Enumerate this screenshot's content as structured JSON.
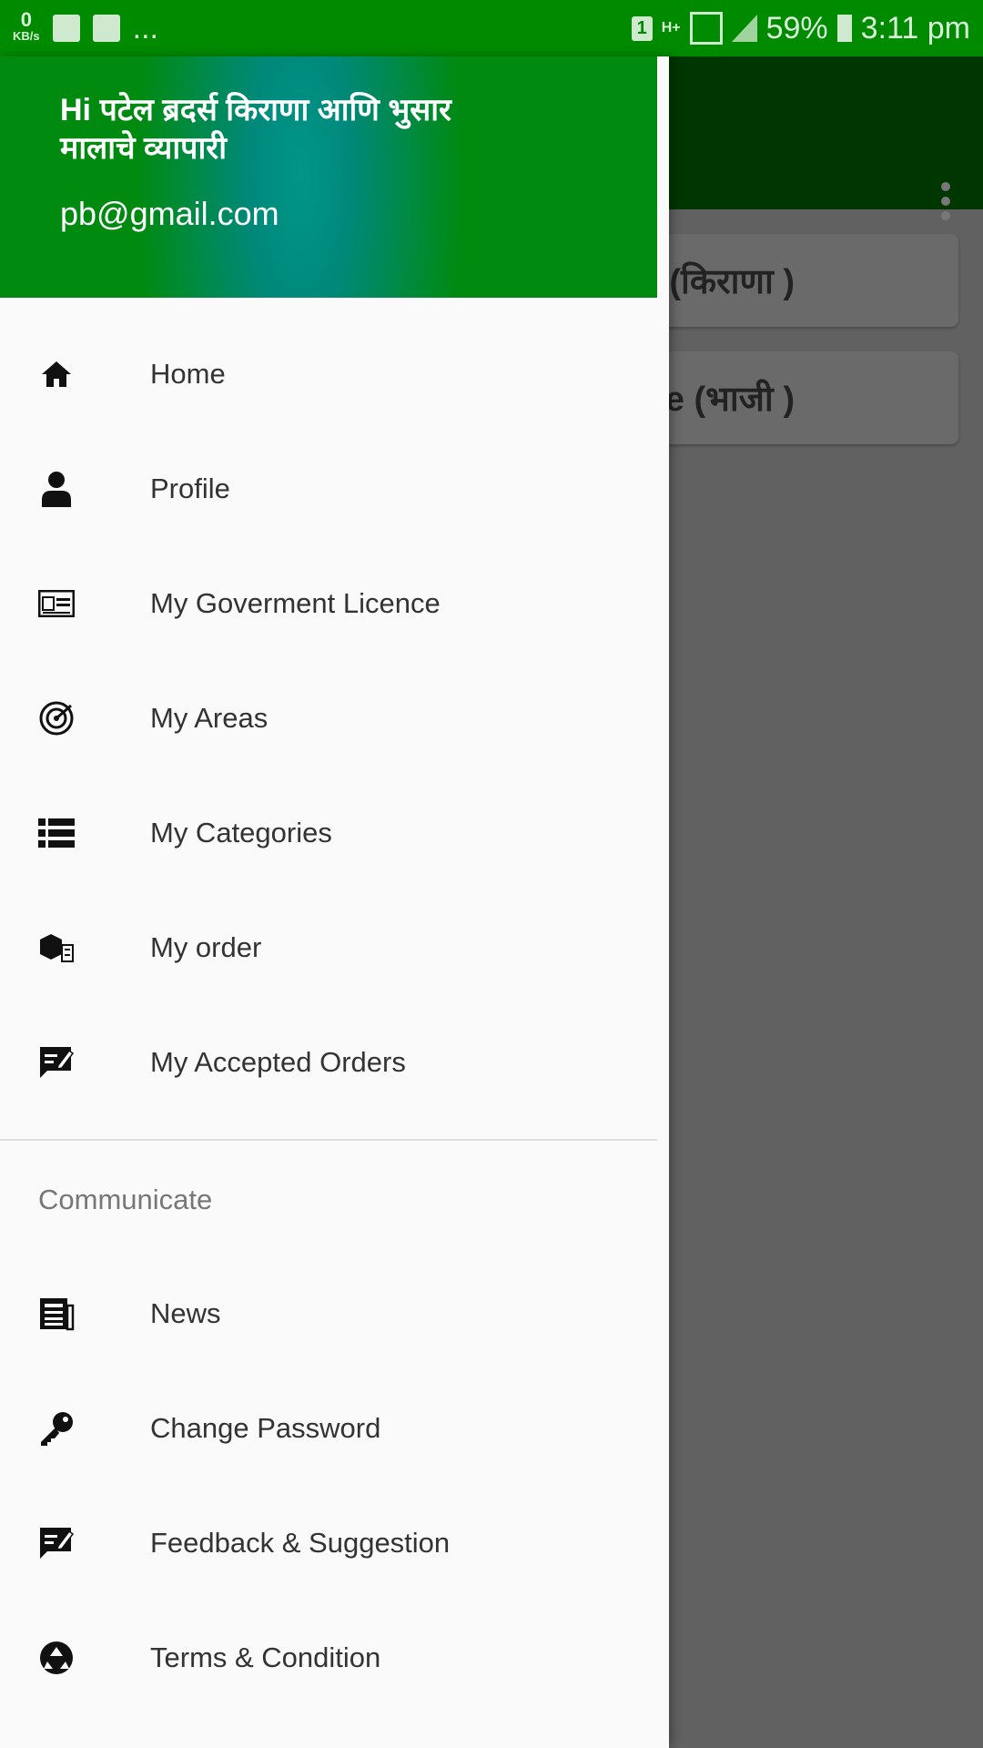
{
  "status_bar": {
    "speed_value": "0",
    "speed_unit": "KB/s",
    "more": "...",
    "sim": "1",
    "network": "H+",
    "battery": "59%",
    "time": "3:11 pm"
  },
  "background": {
    "cards": [
      {
        "label": "(किराणा )"
      },
      {
        "label": "le (भाजी )"
      }
    ]
  },
  "drawer": {
    "header": {
      "name": "Hi पटेल ब्रदर्स किराणा आणि भुसार मालाचे व्यापारी",
      "email": "pb@gmail.com"
    },
    "items": [
      {
        "label": "Home",
        "icon": "home-icon"
      },
      {
        "label": "Profile",
        "icon": "person-icon"
      },
      {
        "label": "My Goverment Licence",
        "icon": "id-card-icon"
      },
      {
        "label": "My Areas",
        "icon": "target-icon"
      },
      {
        "label": "My Categories",
        "icon": "list-icon"
      },
      {
        "label": "My order",
        "icon": "boxes-icon"
      },
      {
        "label": "My Accepted Orders",
        "icon": "edit-message-icon"
      }
    ],
    "section_title": "Communicate",
    "communicate_items": [
      {
        "label": "News",
        "icon": "newspaper-icon"
      },
      {
        "label": "Change Password",
        "icon": "key-icon"
      },
      {
        "label": "Feedback & Suggestion",
        "icon": "edit-message-icon"
      },
      {
        "label": "Terms & Condition",
        "icon": "recycle-icon"
      }
    ]
  },
  "colors": {
    "status_bar": "#008a00",
    "app_bar": "#003600",
    "header_green": "#008a10",
    "header_teal": "#009688"
  }
}
